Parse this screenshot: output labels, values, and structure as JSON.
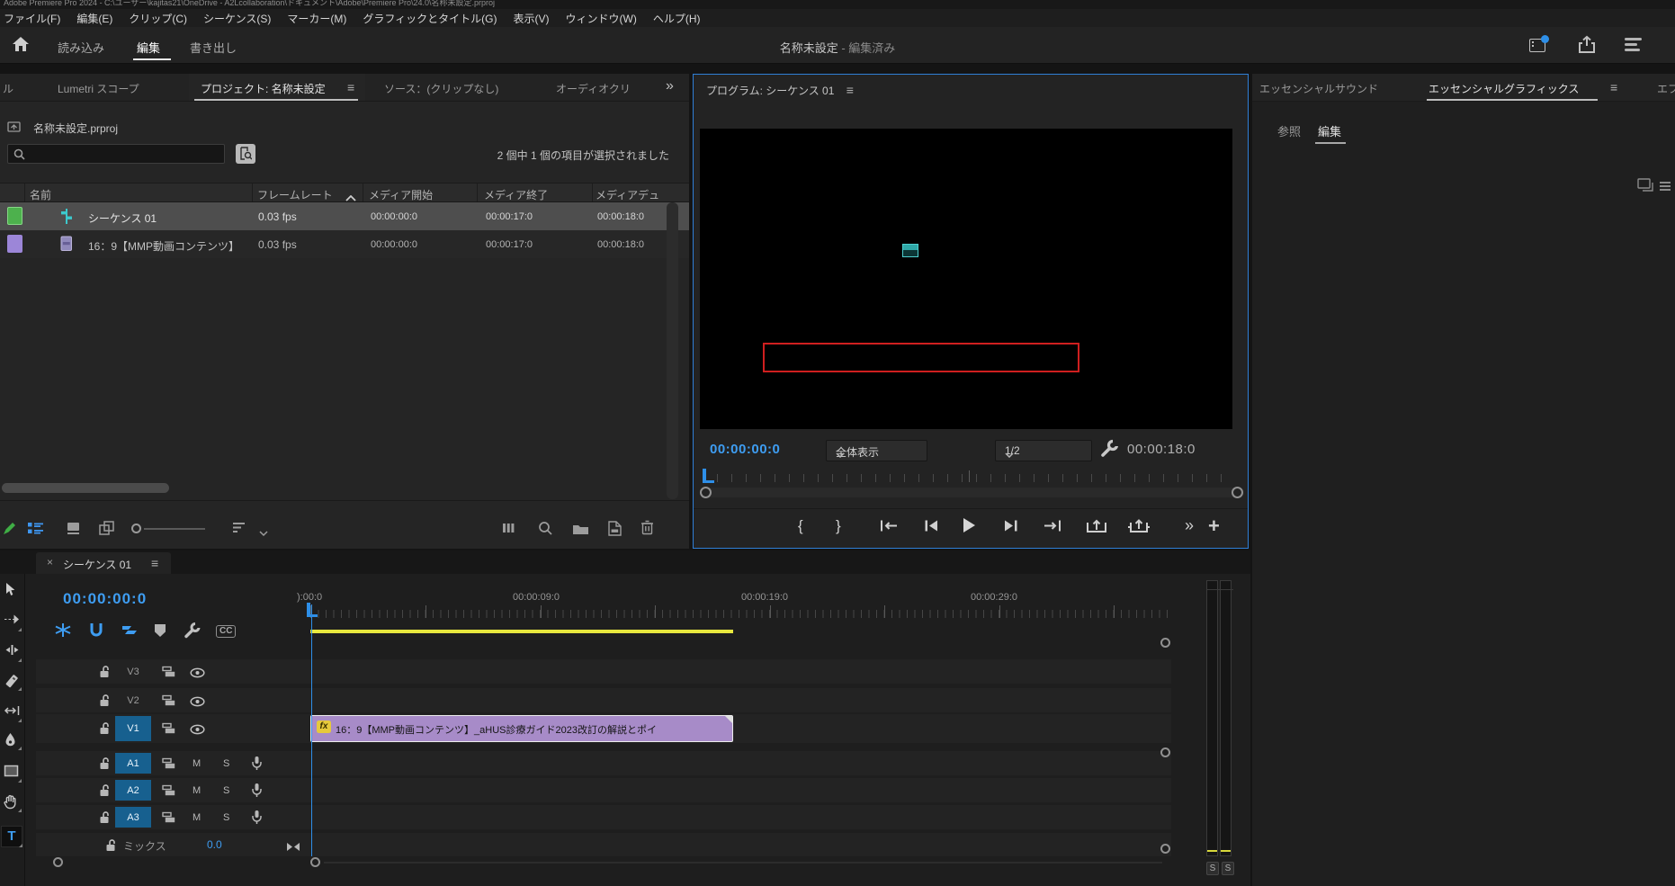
{
  "titlebar": {
    "path": "Adobe Premiere Pro 2024 - C:\\ユーザー\\kajitas21\\OneDrive - A2Lcollaboration\\ドキュメント\\Adobe\\Premiere Pro\\24.0\\名称未設定.prproj"
  },
  "menubar": {
    "items": [
      "ファイル(F)",
      "編集(E)",
      "クリップ(C)",
      "シーケンス(S)",
      "マーカー(M)",
      "グラフィックとタイトル(G)",
      "表示(V)",
      "ウィンドウ(W)",
      "ヘルプ(H)"
    ]
  },
  "appbar": {
    "tab_import": "読み込み",
    "tab_edit": "編集",
    "tab_export": "書き出し",
    "doc_title": "名称未設定",
    "doc_status": "- 編集済み"
  },
  "icons": {
    "panel_menu": "≡",
    "overflow": "»",
    "close": "×",
    "add": "+",
    "mark_in": "{",
    "mark_out": "}"
  },
  "project": {
    "tab_clipped": "ル",
    "tab_lumetri": "Lumetri スコープ",
    "tab_project": "プロジェクト: 名称未設定",
    "tab_source": "ソース：(クリップなし)",
    "tab_audio": "オーディオクリ",
    "file_name": "名称未設定.prproj",
    "selection_status": "2 個中 1 個の項目が選択されました",
    "columns": [
      "名前",
      "フレームレート",
      "メディア開始",
      "メディア終了",
      "メディアデュ"
    ],
    "rows": [
      {
        "name": "シーケンス 01",
        "fps": "0.03 fps",
        "start": "00:00:00:0",
        "end": "00:00:17:0",
        "duration": "00:00:18:0"
      },
      {
        "name": "16：9【MMP動画コンテンツ】",
        "fps": "0.03 fps",
        "start": "00:00:00:0",
        "end": "00:00:17:0",
        "duration": "00:00:18:0"
      }
    ]
  },
  "program": {
    "title": "プログラム: シーケンス 01",
    "current_timecode": "00:00:00:0",
    "fit_select": "全体表示",
    "quality_select": "1/2",
    "duration_timecode": "00:00:18:0"
  },
  "essential": {
    "tab_sound": "エッセンシャルサウンド",
    "tab_graphics": "エッセンシャルグラフィックス",
    "tab_effects_clipped": "エフ",
    "subtab_browse": "参照",
    "subtab_edit": "編集"
  },
  "timeline": {
    "tab": "シーケンス 01",
    "current_timecode": "00:00:00:0",
    "ruler_labels": [
      "):00:0",
      "00:00:09:0",
      "00:00:19:0",
      "00:00:29:0"
    ],
    "video_tracks": [
      "V3",
      "V2",
      "V1"
    ],
    "audio_tracks": [
      "A1",
      "A2",
      "A3"
    ],
    "mute": "M",
    "solo": "S",
    "captions": "CC",
    "mix_label": "ミックス",
    "mix_value": "0.0",
    "clip_name": "16：9【MMP動画コンテンツ】_aHUS診療ガイド2023改訂の解説とポイ",
    "fx_badge": "fx",
    "meter_solo_left": "S",
    "meter_solo_right": "S"
  },
  "tools": {
    "type_label": "T"
  },
  "colors": {
    "accent_blue": "#2e8fe8",
    "timecode_blue": "#3e9df2",
    "clip_purple": "#a78bc8",
    "fx_yellow": "#e6c93c",
    "workarea_yellow": "#e8e83e",
    "item_green": "#4db14d",
    "item_purple": "#9c86d8",
    "frame_red": "#cf1f1f",
    "preview_teal": "#38b0b0",
    "track_badge_blue": "#17608f"
  }
}
